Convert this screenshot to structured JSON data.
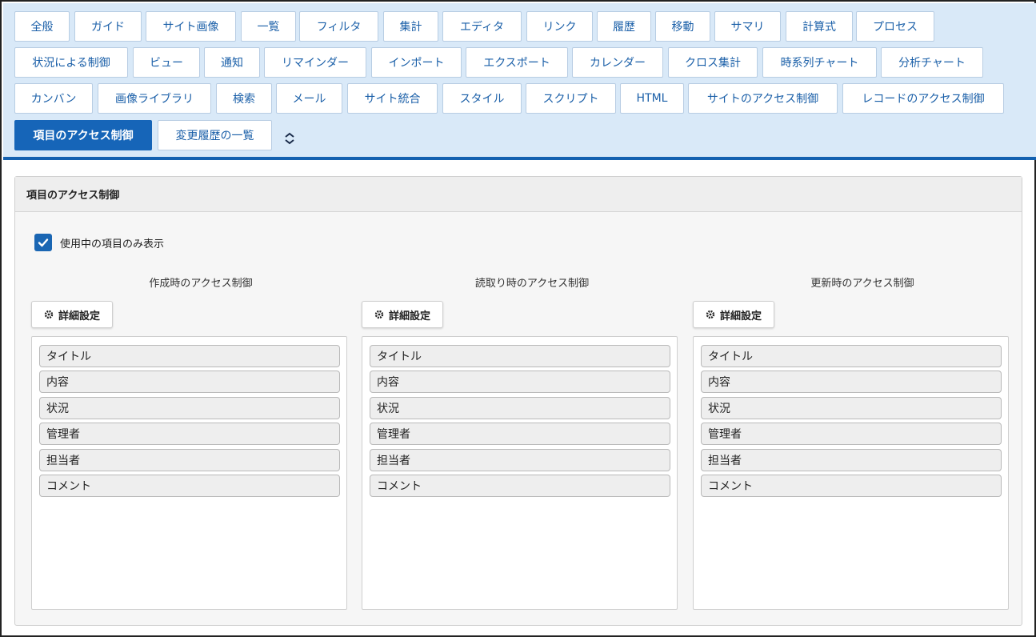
{
  "tabs": [
    "全般",
    "ガイド",
    "サイト画像",
    "一覧",
    "フィルタ",
    "集計",
    "エディタ",
    "リンク",
    "履歴",
    "移動",
    "サマリ",
    "計算式",
    "プロセス",
    "状況による制御",
    "ビュー",
    "通知",
    "リマインダー",
    "インポート",
    "エクスポート",
    "カレンダー",
    "クロス集計",
    "時系列チャート",
    "分析チャート",
    "カンバン",
    "画像ライブラリ",
    "検索",
    "メール",
    "サイト統合",
    "スタイル",
    "スクリプト",
    "HTML",
    "サイトのアクセス制御",
    "レコードのアクセス制御",
    "項目のアクセス制御",
    "変更履歴の一覧"
  ],
  "active_tab": "項目のアクセス制御",
  "panel": {
    "title": "項目のアクセス制御",
    "checkbox_label": "使用中の項目のみ表示",
    "checkbox_checked": true
  },
  "columns": [
    {
      "title": "作成時のアクセス制御",
      "button": "詳細設定",
      "items": [
        "タイトル",
        "内容",
        "状況",
        "管理者",
        "担当者",
        "コメント"
      ]
    },
    {
      "title": "読取り時のアクセス制御",
      "button": "詳細設定",
      "items": [
        "タイトル",
        "内容",
        "状況",
        "管理者",
        "担当者",
        "コメント"
      ]
    },
    {
      "title": "更新時のアクセス制御",
      "button": "詳細設定",
      "items": [
        "タイトル",
        "内容",
        "状況",
        "管理者",
        "担当者",
        "コメント"
      ]
    }
  ],
  "icons": {
    "collapse": "chevron-up-down-icon",
    "settings": "gear-icon",
    "check": "check-icon"
  },
  "colors": {
    "accent": "#1665b8",
    "tab_bar": "#d9e9f8"
  }
}
